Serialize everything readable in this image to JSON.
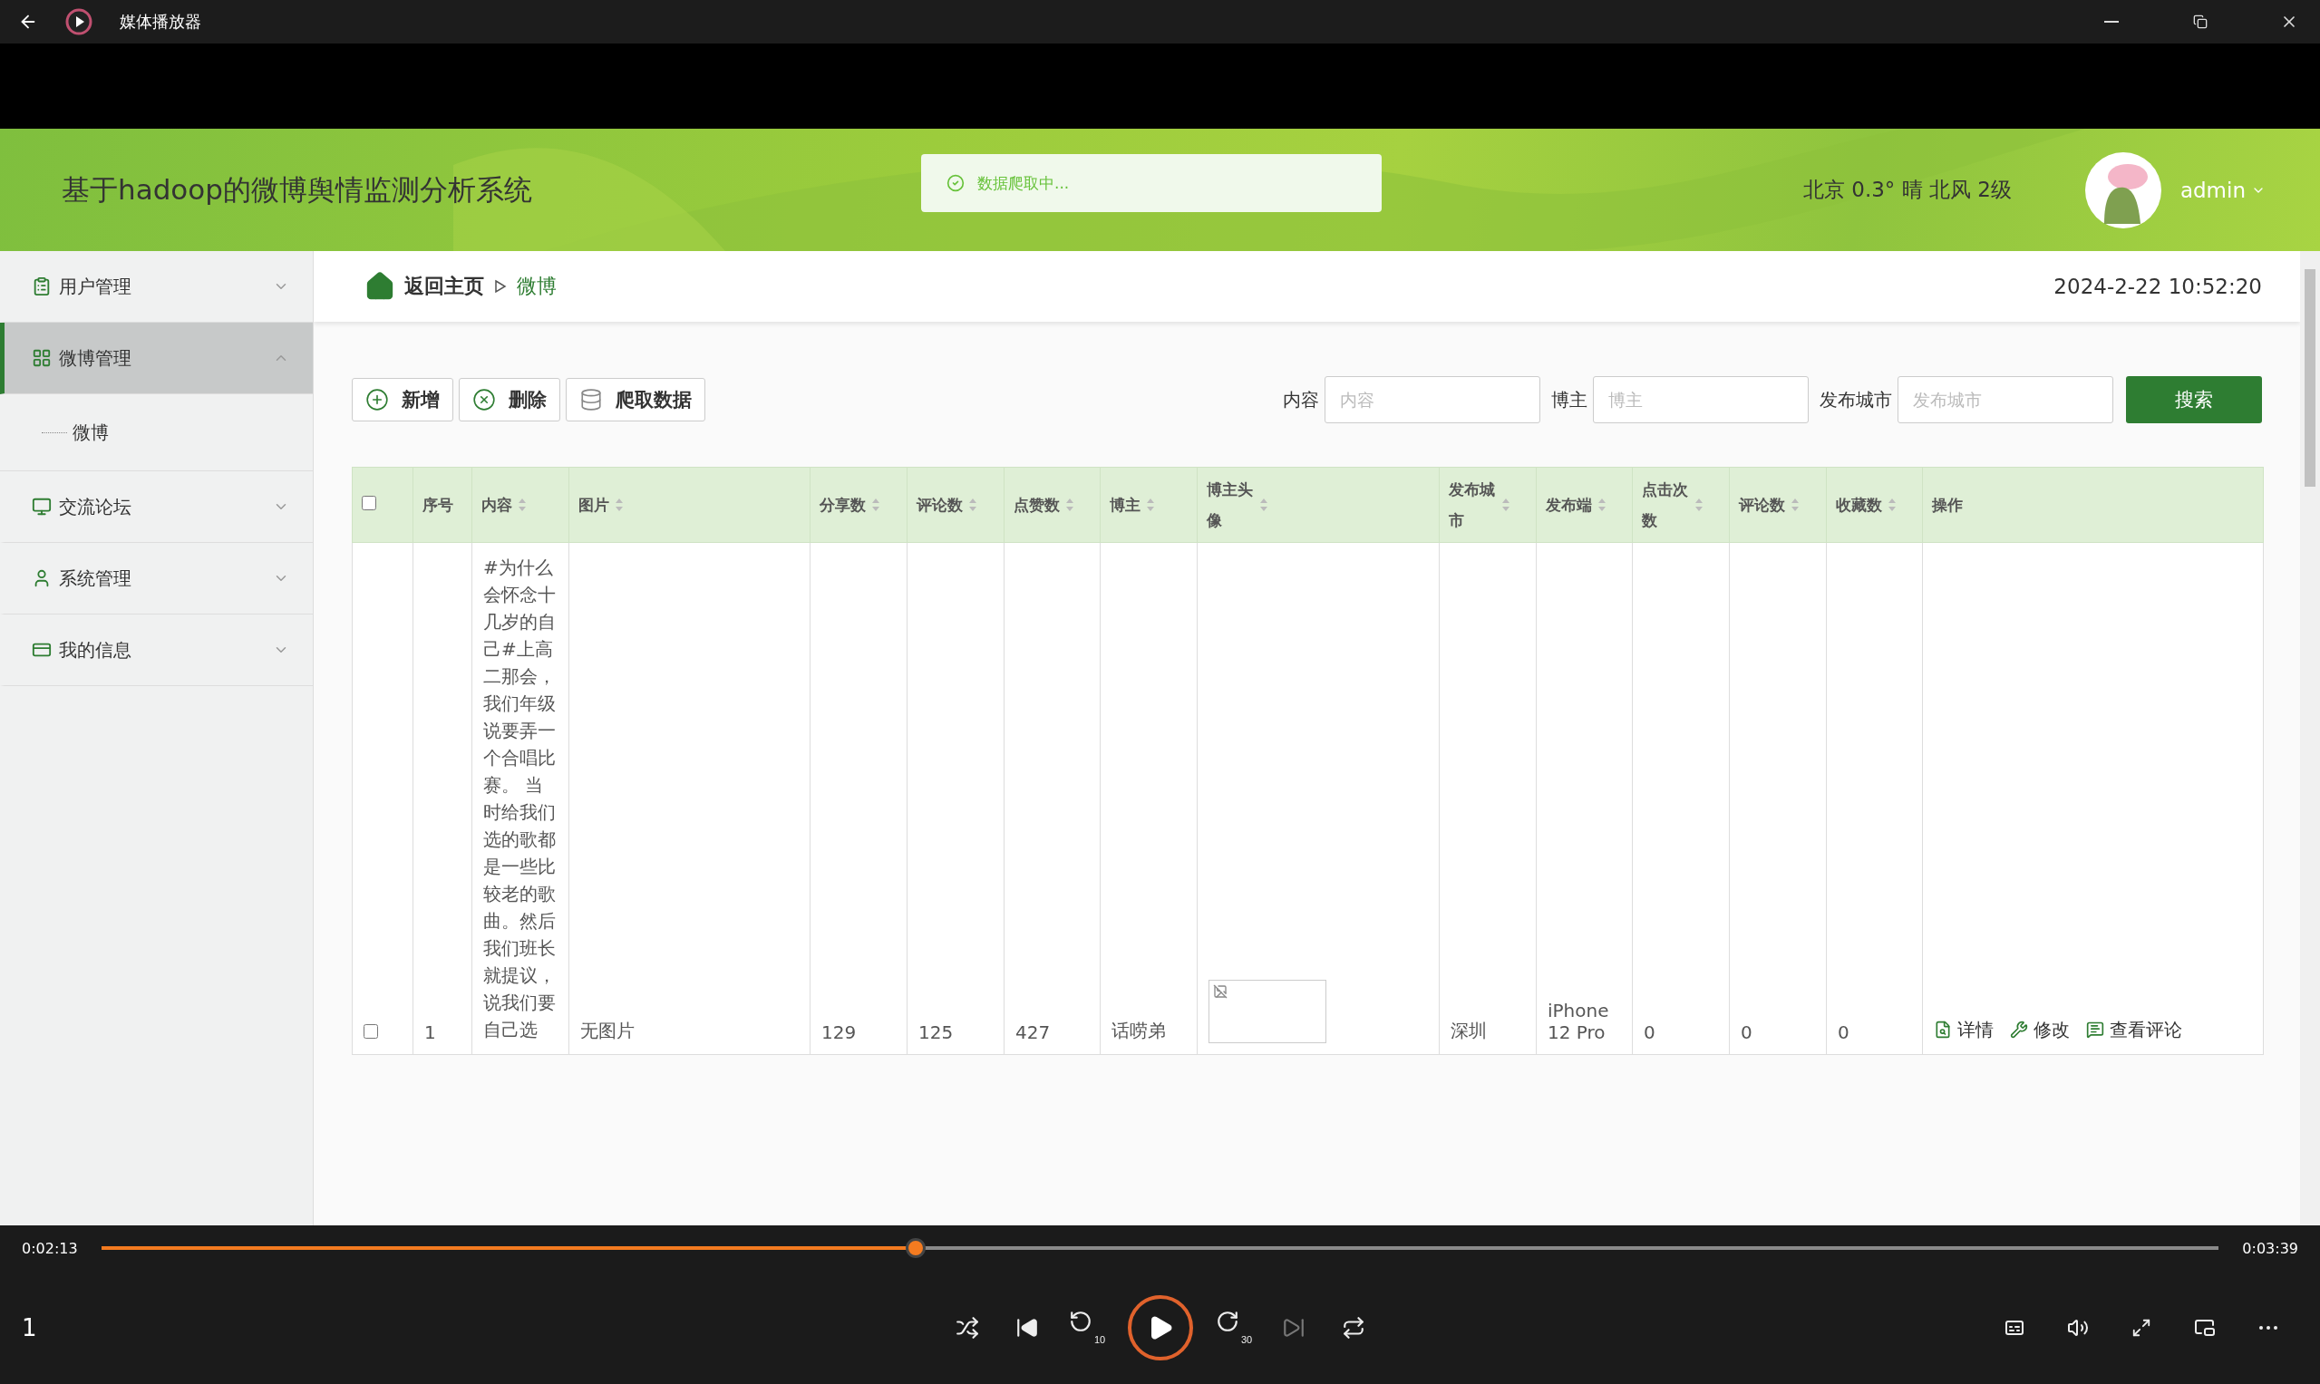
{
  "window": {
    "title": "媒体播放器"
  },
  "app": {
    "title": "基于hadoop的微博舆情监测分析系统",
    "toast": "数据爬取中...",
    "weather": "北京 0.3° 晴 北风 2级",
    "user": "admin"
  },
  "sidebar": {
    "items": [
      {
        "label": "用户管理",
        "expanded": false,
        "selected": false
      },
      {
        "label": "微博管理",
        "expanded": true,
        "selected": true,
        "children": [
          {
            "label": "微博"
          }
        ]
      },
      {
        "label": "交流论坛",
        "expanded": false,
        "selected": false
      },
      {
        "label": "系统管理",
        "expanded": false,
        "selected": false
      },
      {
        "label": "我的信息",
        "expanded": false,
        "selected": false
      }
    ]
  },
  "breadcrumb": {
    "home": "返回主页",
    "current": "微博"
  },
  "datetime": "2024-2-22 10:52:20",
  "toolbar": {
    "buttons": [
      {
        "kind": "add",
        "label": "新增"
      },
      {
        "kind": "delete",
        "label": "删除"
      },
      {
        "kind": "crawl",
        "label": "爬取数据"
      }
    ]
  },
  "search": {
    "fields": [
      {
        "label": "内容",
        "placeholder": "内容"
      },
      {
        "label": "博主",
        "placeholder": "博主"
      },
      {
        "label": "发布城市",
        "placeholder": "发布城市"
      }
    ],
    "button": "搜索"
  },
  "table": {
    "all_checked": false,
    "columns": [
      {
        "label": "序号",
        "sortable": false
      },
      {
        "label": "内容",
        "sortable": true
      },
      {
        "label": "图片",
        "sortable": true
      },
      {
        "label": "分享数",
        "sortable": true
      },
      {
        "label": "评论数",
        "sortable": true
      },
      {
        "label": "点赞数",
        "sortable": true
      },
      {
        "label": "博主",
        "sortable": true
      },
      {
        "label": "博主头像",
        "sortable": true
      },
      {
        "label": "发布城市",
        "sortable": true
      },
      {
        "label": "发布端",
        "sortable": true
      },
      {
        "label": "点击次数",
        "sortable": true
      },
      {
        "label": "评论数",
        "sortable": true
      },
      {
        "label": "收藏数",
        "sortable": true
      },
      {
        "label": "操作",
        "sortable": false
      }
    ],
    "rows": [
      {
        "checked": false,
        "cells": [
          "1",
          "#为什么会怀念十几岁的自己#上高二那会，我们年级说要弄一个合唱比赛。 当时给我们选的歌都是一些比较老的歌曲。然后我们班长就提议，说我们要自己选",
          "无图片",
          "129",
          "125",
          "427",
          "话唠弟",
          "",
          "深圳",
          "iPhone 12 Pro",
          "0",
          "0",
          "0"
        ],
        "actions": [
          {
            "kind": "detail",
            "label": "详情"
          },
          {
            "kind": "edit",
            "label": "修改"
          },
          {
            "kind": "comments",
            "label": "查看评论"
          }
        ]
      }
    ]
  },
  "player": {
    "elapsed": "0:02:13",
    "total": "0:03:39",
    "level": 0.38,
    "counter": "1",
    "rewind": "10",
    "forward": "30"
  }
}
